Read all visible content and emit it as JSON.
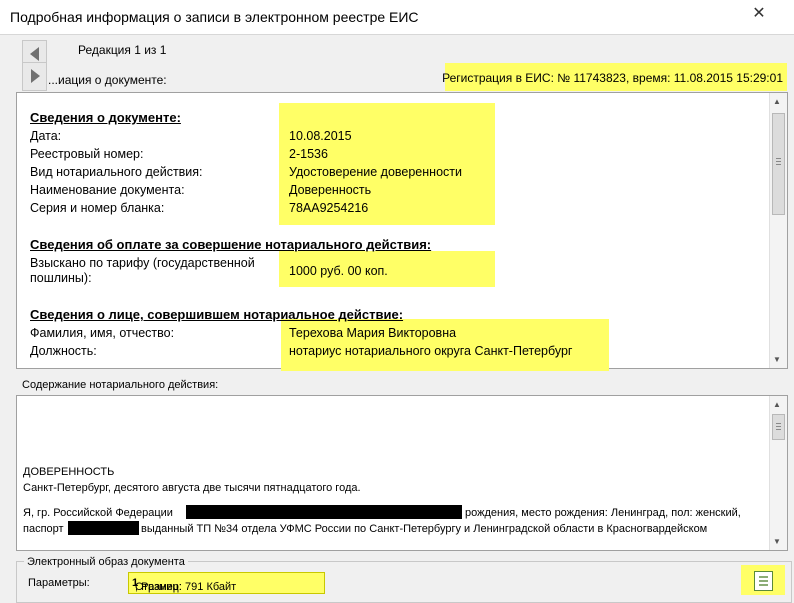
{
  "window": {
    "title": "Подробная информация о записи в электронном реестре ЕИС",
    "close_glyph": "✕"
  },
  "nav": {
    "edition_text": "Редакция 1 из 1",
    "docinfo_label": "...иация о документе:",
    "registration": "Регистрация в ЕИС: № 11743823, время: 11.08.2015 15:29:01"
  },
  "document": {
    "section1_title": "Сведения о документе:",
    "fields": [
      {
        "label": "Дата:",
        "value": "10.08.2015"
      },
      {
        "label": "Реестровый номер:",
        "value": "2-1536"
      },
      {
        "label": "Вид нотариального действия:",
        "value": "Удостоверение доверенности"
      },
      {
        "label": "Наименование документа:",
        "value": "Доверенность"
      },
      {
        "label": "Серия и номер бланка:",
        "value": "78АА9254216"
      }
    ],
    "section2_title": "Сведения об оплате за совершение нотариального действия:",
    "payment_label_line1": "Взыскано по тарифу (государственной",
    "payment_label_line2": "пошлины):",
    "payment_value": "1000 руб.  00 коп.",
    "section3_title": "Сведения о лице, совершившем нотариальное действие:",
    "person_fields": [
      {
        "label": "Фамилия, имя, отчество:",
        "value": "Терехова Мария Викторовна"
      },
      {
        "label": "Должность:",
        "value": "нотариус нотариального округа Санкт-Петербург"
      }
    ]
  },
  "content": {
    "label": "Содержание нотариального действия:",
    "line1": "ДОВЕРЕННОСТЬ",
    "line2": "Санкт-Петербург, десятого августа две тысячи пятнадцатого года.",
    "line3a": "Я, гр. Российской Федерации",
    "line3b": "рождения, место рождения: Ленинград, пол: женский,",
    "line4a": "паспорт",
    "line4b": "выданный ТП №34 отдела УФМС России по Санкт-Петербургу и Ленинградской области в Красногвардейском"
  },
  "eimage": {
    "group_label": "Электронный образ документа",
    "params_label": "Параметры:",
    "params_prefix": "Страниц: ",
    "pages": "1",
    "params_suffix": ", Размер: 791 Кбайт"
  },
  "colors": {
    "highlight": "#ffff66",
    "accent_green": "#5a8a3a"
  }
}
